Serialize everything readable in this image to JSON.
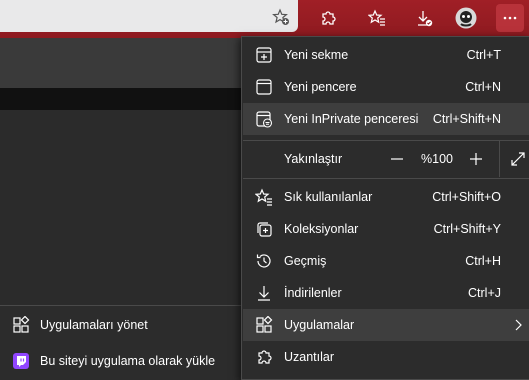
{
  "menu": {
    "items": [
      {
        "label": "Yeni sekme",
        "shortcut": "Ctrl+T",
        "icon": "new-tab-icon"
      },
      {
        "label": "Yeni pencere",
        "shortcut": "Ctrl+N",
        "icon": "new-window-icon"
      },
      {
        "label": "Yeni InPrivate penceresi",
        "shortcut": "Ctrl+Shift+N",
        "icon": "inprivate-window-icon"
      }
    ],
    "zoom": {
      "label": "Yakınlaştır",
      "value": "%100",
      "minus": "—",
      "plus": "+"
    },
    "items2": [
      {
        "label": "Sık kullanılanlar",
        "shortcut": "Ctrl+Shift+O",
        "icon": "favorites-icon"
      },
      {
        "label": "Koleksiyonlar",
        "shortcut": "Ctrl+Shift+Y",
        "icon": "collections-icon"
      },
      {
        "label": "Geçmiş",
        "shortcut": "Ctrl+H",
        "icon": "history-icon"
      },
      {
        "label": "İndirilenler",
        "shortcut": "Ctrl+J",
        "icon": "downloads-icon"
      },
      {
        "label": "Uygulamalar",
        "shortcut": "",
        "icon": "apps-icon"
      },
      {
        "label": "Uzantılar",
        "shortcut": "",
        "icon": "extensions-icon"
      }
    ]
  },
  "submenu": {
    "items": [
      {
        "label": "Uygulamaları yönet",
        "icon": "apps-grid-icon"
      },
      {
        "label": "Bu siteyi uygulama olarak yükle",
        "icon": "twitch-icon"
      }
    ]
  },
  "colors": {
    "toolbar": "#a01f26",
    "menu_bg": "#2c2c2c",
    "highlight": "#3e3e3e"
  }
}
